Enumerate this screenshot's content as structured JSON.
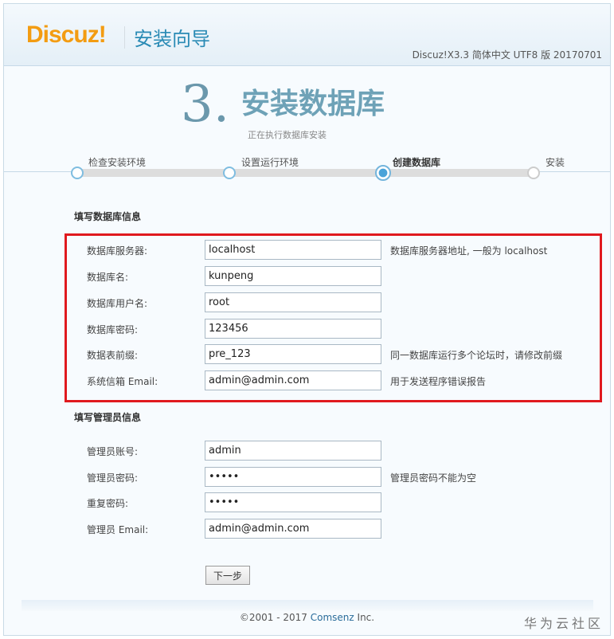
{
  "header": {
    "logo": "Discuz!",
    "wizard": "安装向导",
    "version": "Discuz!X3.3 简体中文 UTF8 版 20170701"
  },
  "step": {
    "number": "3.",
    "title": "安装数据库",
    "subtitle": "正在执行数据库安装"
  },
  "steps": [
    {
      "label": "检查安装环境",
      "state": "done"
    },
    {
      "label": "设置运行环境",
      "state": "done"
    },
    {
      "label": "创建数据库",
      "state": "current"
    },
    {
      "label": "安装",
      "state": "todo"
    }
  ],
  "db_section": {
    "title": "填写数据库信息",
    "rows": [
      {
        "label": "数据库服务器:",
        "value": "localhost",
        "tip": "数据库服务器地址, 一般为 localhost"
      },
      {
        "label": "数据库名:",
        "value": "kunpeng",
        "tip": ""
      },
      {
        "label": "数据库用户名:",
        "value": "root",
        "tip": ""
      },
      {
        "label": "数据库密码:",
        "value": "123456",
        "tip": ""
      },
      {
        "label": "数据表前缀:",
        "value": "pre_123",
        "tip": "同一数据库运行多个论坛时，请修改前缀"
      },
      {
        "label": "系统信箱 Email:",
        "value": "admin@admin.com",
        "tip": "用于发送程序错误报告"
      }
    ]
  },
  "admin_section": {
    "title": "填写管理员信息",
    "rows": [
      {
        "label": "管理员账号:",
        "value": "admin",
        "tip": ""
      },
      {
        "label": "管理员密码:",
        "value": "•••••",
        "tip": "管理员密码不能为空"
      },
      {
        "label": "重复密码:",
        "value": "•••••",
        "tip": ""
      },
      {
        "label": "管理员 Email:",
        "value": "admin@admin.com",
        "tip": ""
      }
    ]
  },
  "next_button": "下一步",
  "footer": {
    "copy_prefix": "©2001 - 2017 ",
    "company": "Comsenz",
    "copy_suffix": " Inc.",
    "watermark": "华为云社区"
  }
}
